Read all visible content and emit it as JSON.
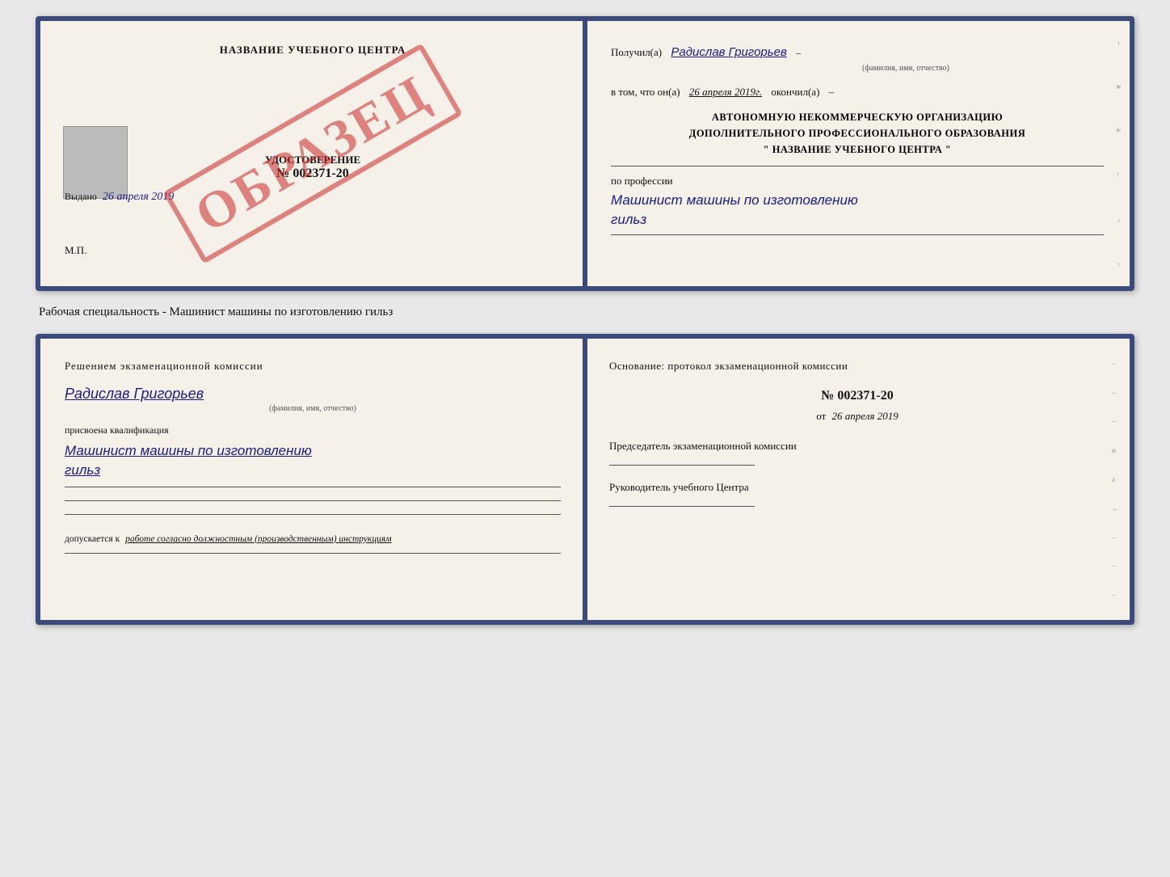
{
  "doc1": {
    "left": {
      "title": "НАЗВАНИЕ УЧЕБНОГО ЦЕНТРА",
      "watermark": "ОБРАЗЕЦ",
      "cert_label": "УДОСТОВЕРЕНИЕ",
      "cert_number": "№ 002371-20",
      "issued_label": "Выдано",
      "issued_date": "26 апреля 2019",
      "stamp_label": "М.П."
    },
    "right": {
      "received_label": "Получил(а)",
      "recipient_name": "Радислав Григорьев",
      "name_sublabel": "(фамилия, имя, отчество)",
      "date_label": "в том, что он(а)",
      "date_value": "26 апреля 2019г.",
      "finished_label": "окончил(а)",
      "org_line1": "АВТОНОМНУЮ НЕКОММЕРЧЕСКУЮ ОРГАНИЗАЦИЮ",
      "org_line2": "ДОПОЛНИТЕЛЬНОГО ПРОФЕССИОНАЛЬНОГО ОБРАЗОВАНИЯ",
      "org_name": "\" НАЗВАНИЕ УЧЕБНОГО ЦЕНТРА \"",
      "profession_label": "по профессии",
      "profession_value": "Машинист машины по изготовлению",
      "profession_value2": "гильз"
    }
  },
  "between_label": "Рабочая специальность - Машинист машины по изготовлению гильз",
  "doc2": {
    "left": {
      "commission_title": "Решением  экзаменационной  комиссии",
      "person_name": "Радислав Григорьев",
      "name_sublabel": "(фамилия, имя, отчество)",
      "qualification_label": "присвоена квалификация",
      "qualification_value": "Машинист  машины  по  изготовлению",
      "qualification_value2": "гильз",
      "допуск_prefix": "допускается к",
      "допуск_italic": "работе согласно должностным (производственным) инструкциям"
    },
    "right": {
      "osnovaniye_title": "Основание: протокол экзаменационной  комиссии",
      "protocol_number": "№  002371-20",
      "date_prefix": "от",
      "date_value": "26 апреля 2019",
      "chairman_title": "Председатель экзаменационной комиссии",
      "director_title": "Руководитель учебного Центра"
    }
  }
}
